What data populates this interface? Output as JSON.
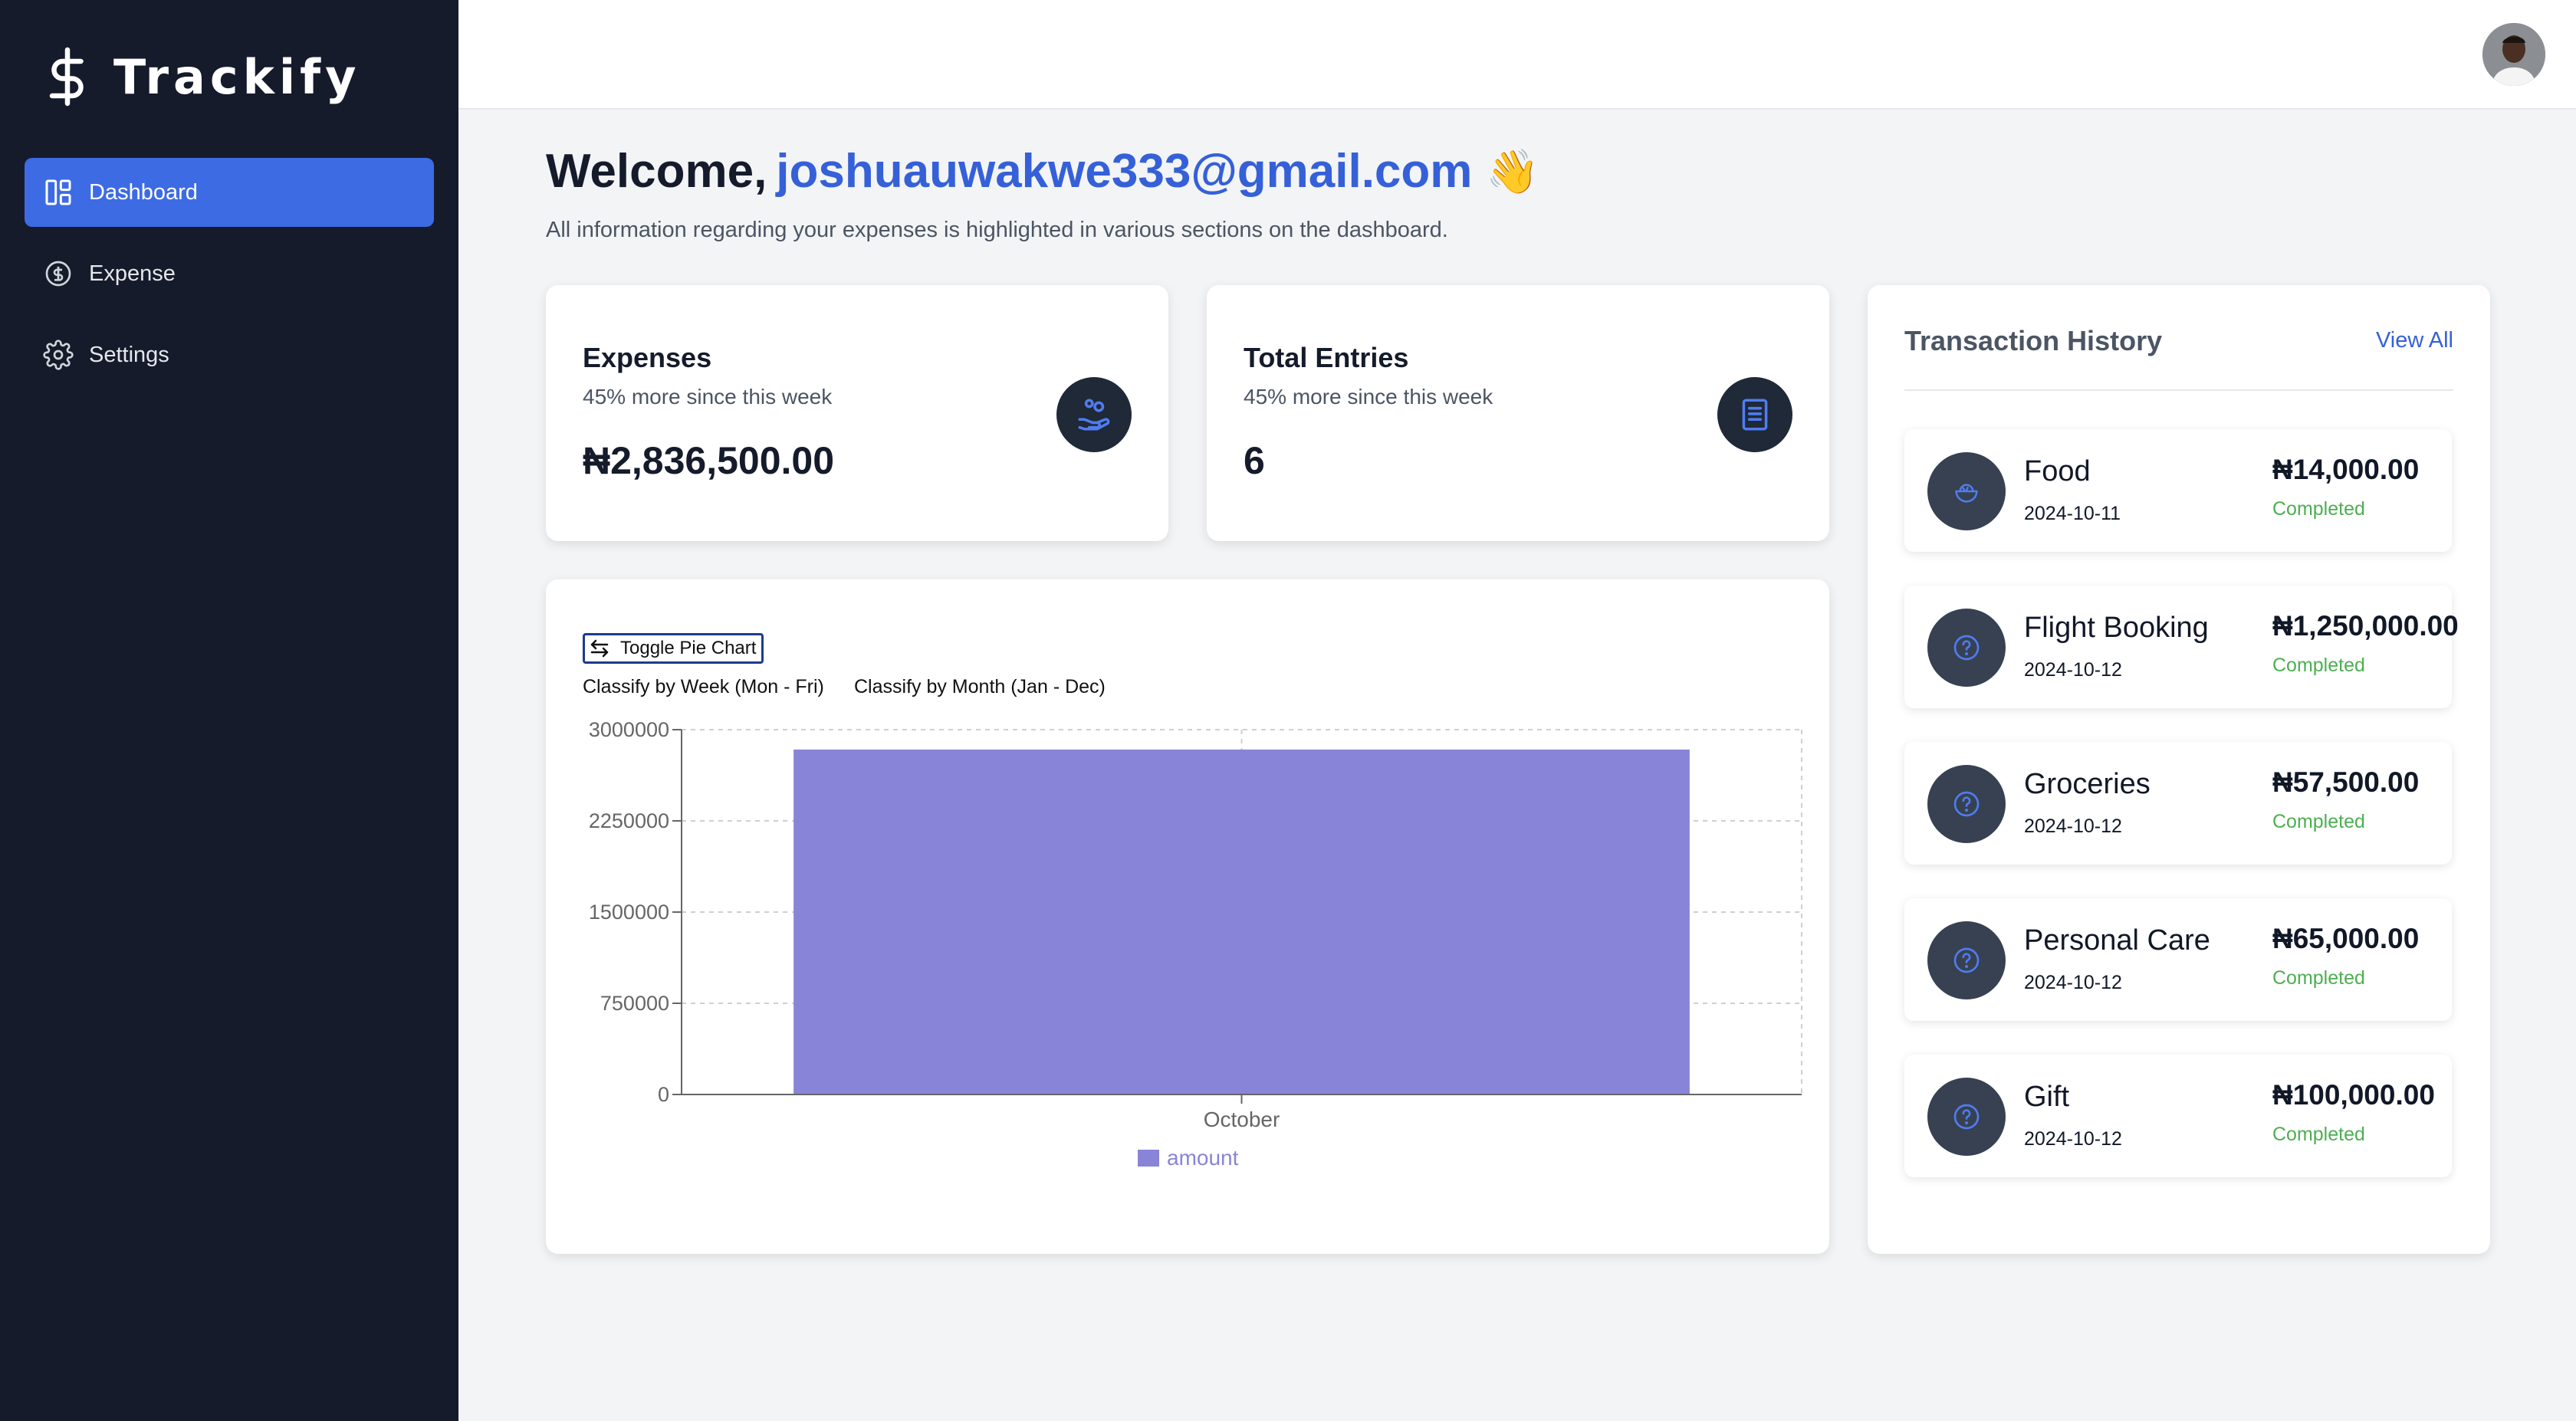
{
  "brand": {
    "name": "Trackify"
  },
  "sidebar": {
    "items": [
      {
        "label": "Dashboard",
        "icon": "dashboard-icon",
        "active": true
      },
      {
        "label": "Expense",
        "icon": "dollar-circle-icon",
        "active": false
      },
      {
        "label": "Settings",
        "icon": "gear-icon",
        "active": false
      }
    ]
  },
  "welcome": {
    "greeting": "Welcome,",
    "email": "joshuauwakwe333@gmail.com",
    "emoji": "👋",
    "subtitle": "All information regarding your expenses is highlighted in various sections on the dashboard."
  },
  "stats": {
    "expenses": {
      "title": "Expenses",
      "subtitle": "45% more since this week",
      "value": "₦2,836,500.00"
    },
    "entries": {
      "title": "Total Entries",
      "subtitle": "45% more since this week",
      "value": "6"
    }
  },
  "chart_controls": {
    "toggle_label": "Toggle Pie Chart",
    "week_label": "Classify by Week (Mon - Fri)",
    "month_label": "Classify by Month (Jan - Dec)"
  },
  "chart_data": {
    "type": "bar",
    "categories": [
      "October"
    ],
    "series": [
      {
        "name": "amount",
        "values": [
          2836500
        ],
        "color": "#8884d8"
      }
    ],
    "yticks": [
      "0",
      "750000",
      "1500000",
      "2250000",
      "3000000"
    ],
    "ylim": [
      0,
      3000000
    ],
    "grid": true,
    "legend": "bottom"
  },
  "transactions": {
    "title": "Transaction History",
    "view_all": "View All",
    "items": [
      {
        "name": "Food",
        "date": "2024-10-11",
        "amount": "₦14,000.00",
        "status": "Completed",
        "icon": "food-bowl-icon"
      },
      {
        "name": "Flight Booking",
        "date": "2024-10-12",
        "amount": "₦1,250,000.00",
        "status": "Completed",
        "icon": "question-circle-icon"
      },
      {
        "name": "Groceries",
        "date": "2024-10-12",
        "amount": "₦57,500.00",
        "status": "Completed",
        "icon": "question-circle-icon"
      },
      {
        "name": "Personal Care",
        "date": "2024-10-12",
        "amount": "₦65,000.00",
        "status": "Completed",
        "icon": "question-circle-icon"
      },
      {
        "name": "Gift",
        "date": "2024-10-12",
        "amount": "₦100,000.00",
        "status": "Completed",
        "icon": "question-circle-icon"
      }
    ]
  },
  "colors": {
    "sidebar": "#151b2b",
    "accent": "#3d6be4",
    "link": "#3560d8",
    "success": "#4caf50",
    "bar": "#8884d8"
  }
}
